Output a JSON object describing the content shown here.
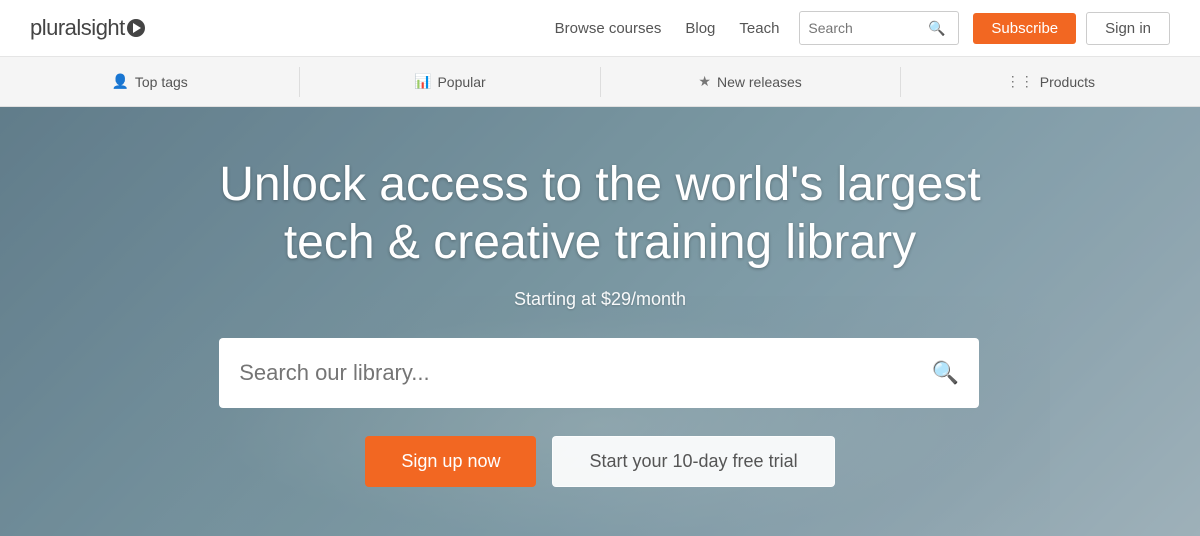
{
  "header": {
    "logo_text": "pluralsight",
    "nav": {
      "browse": "Browse courses",
      "blog": "Blog",
      "teach": "Teach"
    },
    "search_placeholder": "Search",
    "subscribe_label": "Subscribe",
    "signin_label": "Sign in"
  },
  "navbar": {
    "items": [
      {
        "icon": "person-icon",
        "label": "Top tags"
      },
      {
        "icon": "chart-icon",
        "label": "Popular"
      },
      {
        "icon": "star-icon",
        "label": "New releases"
      },
      {
        "icon": "grid-icon",
        "label": "Products"
      }
    ]
  },
  "hero": {
    "title_line1": "Unlock access to the world's largest",
    "title_line2": "tech & creative training library",
    "subtitle": "Starting at $29/month",
    "search_placeholder": "Search our library...",
    "signup_label": "Sign up now",
    "trial_label": "Start your 10-day free trial"
  },
  "colors": {
    "orange": "#f26722",
    "dark_text": "#444",
    "light_text": "#555"
  }
}
